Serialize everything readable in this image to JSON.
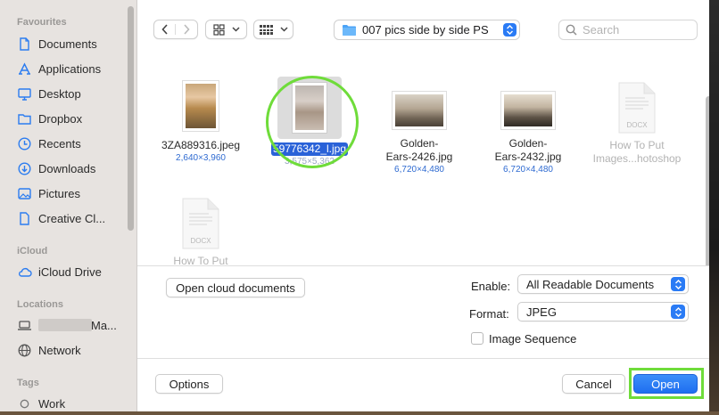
{
  "colors": {
    "accent": "#2a7bf5",
    "selection": "#2a62d8",
    "highlight_ring": "#6fdc3a",
    "dims_text": "#2e6ad1"
  },
  "sidebar": {
    "favourites_heading": "Favourites",
    "favourites": [
      {
        "label": "Documents",
        "icon": "document-icon"
      },
      {
        "label": "Applications",
        "icon": "applications-icon"
      },
      {
        "label": "Desktop",
        "icon": "desktop-icon"
      },
      {
        "label": "Dropbox",
        "icon": "folder-icon"
      },
      {
        "label": "Recents",
        "icon": "clock-icon"
      },
      {
        "label": "Downloads",
        "icon": "download-icon"
      },
      {
        "label": "Pictures",
        "icon": "pictures-icon"
      },
      {
        "label": "Creative Cl...",
        "icon": "document-icon"
      }
    ],
    "icloud_heading": "iCloud",
    "icloud": [
      {
        "label": "iCloud Drive",
        "icon": "cloud-icon"
      }
    ],
    "locations_heading": "Locations",
    "locations": [
      {
        "label": "Ma...",
        "icon": "laptop-icon"
      },
      {
        "label": "Network",
        "icon": "globe-icon"
      }
    ],
    "tags_heading": "Tags",
    "tags": [
      {
        "label": "Work",
        "icon": "tag-circle-icon"
      }
    ]
  },
  "toolbar": {
    "folder_name": "007 pics side by side PS",
    "search_placeholder": "Search"
  },
  "files": [
    {
      "name": "3ZA889316.jpeg",
      "dims": "2,640×3,960",
      "kind": "image"
    },
    {
      "name": "59776342_l.jpg",
      "dims": "3,575×5,362",
      "kind": "image",
      "selected": true
    },
    {
      "name": "Golden-",
      "name2": "Ears-2426.jpg",
      "dims": "6,720×4,480",
      "kind": "image"
    },
    {
      "name": "Golden-",
      "name2": "Ears-2432.jpg",
      "dims": "6,720×4,480",
      "kind": "image"
    },
    {
      "name": "How To Put",
      "name2": "Images...hotoshop",
      "kind": "docx",
      "badge": "DOCX"
    },
    {
      "name": "How To Put",
      "kind": "docx",
      "badge": "DOCX"
    }
  ],
  "options_panel": {
    "open_cloud_label": "Open cloud documents",
    "enable_label": "Enable:",
    "enable_value": "All Readable Documents",
    "format_label": "Format:",
    "format_value": "JPEG",
    "image_sequence_label": "Image Sequence"
  },
  "footer": {
    "options_label": "Options",
    "cancel_label": "Cancel",
    "open_label": "Open"
  }
}
